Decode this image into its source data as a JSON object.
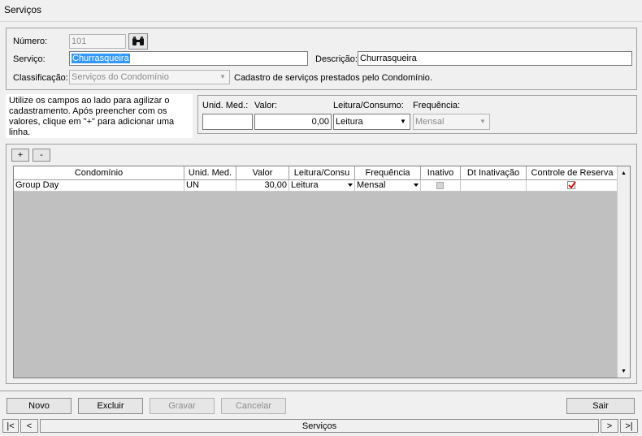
{
  "window": {
    "title": "Serviços"
  },
  "form": {
    "numero_label": "Número:",
    "numero_value": "101",
    "servico_label": "Serviço:",
    "servico_value": "Churrasqueira",
    "descricao_label": "Descrição:",
    "descricao_value": "Churrasqueira",
    "classificacao_label": "Classificação:",
    "classificacao_value": "Serviços do Condomínio",
    "classificacao_note": "Cadastro de serviços prestados pelo Condomínio."
  },
  "quick_add": {
    "hint": "Utilize os campos ao lado para agilizar o cadastramento. Após preencher com os valores, clique em \"+\" para adicionar uma linha.",
    "unid_label": "Unid. Med.:",
    "unid_value": "",
    "valor_label": "Valor:",
    "valor_value": "0,00",
    "leitura_label": "Leitura/Consumo:",
    "leitura_value": "Leitura",
    "frequencia_label": "Frequência:",
    "frequencia_value": "Mensal"
  },
  "grid": {
    "add_label": "+",
    "remove_label": "-",
    "columns": [
      "Condomínio",
      "Unid. Med.",
      "Valor",
      "Leitura/Consu",
      "Frequência",
      "Inativo",
      "Dt Inativação",
      "Controle de Reserva"
    ],
    "rows": [
      {
        "condominio": "Group Day",
        "unid": "UN",
        "valor": "30,00",
        "leitura": "Leitura",
        "frequencia": "Mensal",
        "inativo": false,
        "dt_inativacao": "",
        "controle_reserva": true
      }
    ]
  },
  "actions": {
    "novo": "Novo",
    "excluir": "Excluir",
    "gravar": "Gravar",
    "cancelar": "Cancelar",
    "sair": "Sair"
  },
  "navigator": {
    "first": "|<",
    "prev": "<",
    "caption": "Serviços",
    "next": ">",
    "last": ">|"
  },
  "colors": {
    "selection": "#3399ff",
    "grid_empty": "#c0c0c0",
    "check_mark": "#cc0000"
  }
}
